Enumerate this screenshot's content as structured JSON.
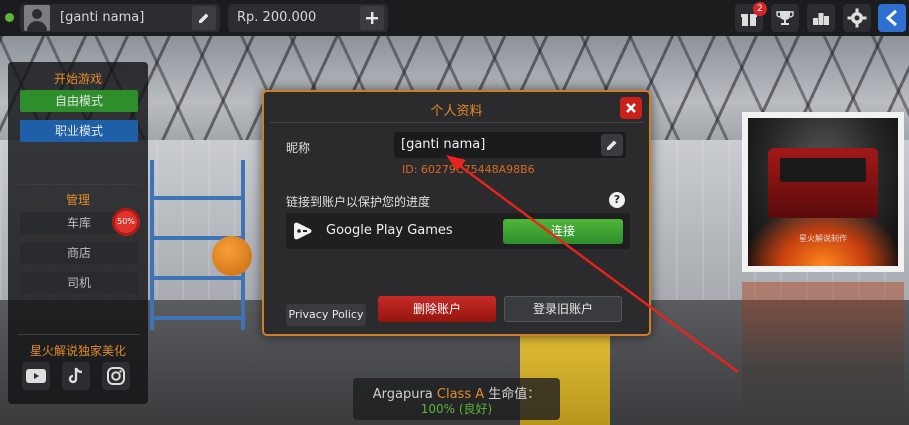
{
  "topbar": {
    "player_name": "[ganti nama]",
    "money": "Rp. 200.000",
    "gift_count": "2",
    "icons": [
      "gift-icon",
      "trophy-icon",
      "leaderboard-icon",
      "settings-gear-icon",
      "back-chevron-icon"
    ]
  },
  "left_menu": {
    "play_section": "开始游戏",
    "free_mode": "自由模式",
    "career_mode": "职业模式",
    "manage_section": "管理",
    "garage": "车库",
    "sale_badge": "50%",
    "shop": "商店",
    "drivers": "司机",
    "credit": "星火解说独家美化",
    "socials": [
      "youtube-icon",
      "tiktok-icon",
      "instagram-icon"
    ]
  },
  "modal": {
    "title": "个人资料",
    "nickname_label": "昵称",
    "nickname_value": "[ganti nama]",
    "player_id": "ID: 60279C75448A98B6",
    "link_label": "链接到账户以保护您的进度",
    "google_play_label": "Google Play Games",
    "connect_label": "连接",
    "privacy_label": "Privacy Policy",
    "delete_label": "删除账户",
    "login_old_label": "登录旧账户"
  },
  "truck_info": {
    "name": "Argapura",
    "class": "Class A",
    "health_label": "生命值：",
    "health_value": "100% (良好)"
  },
  "poster": {
    "caption": "星火解说制作"
  },
  "colors": {
    "accent_orange": "#e58a2a",
    "green": "#2f8e2c",
    "blue": "#1e5fa8",
    "red": "#c9201d"
  }
}
